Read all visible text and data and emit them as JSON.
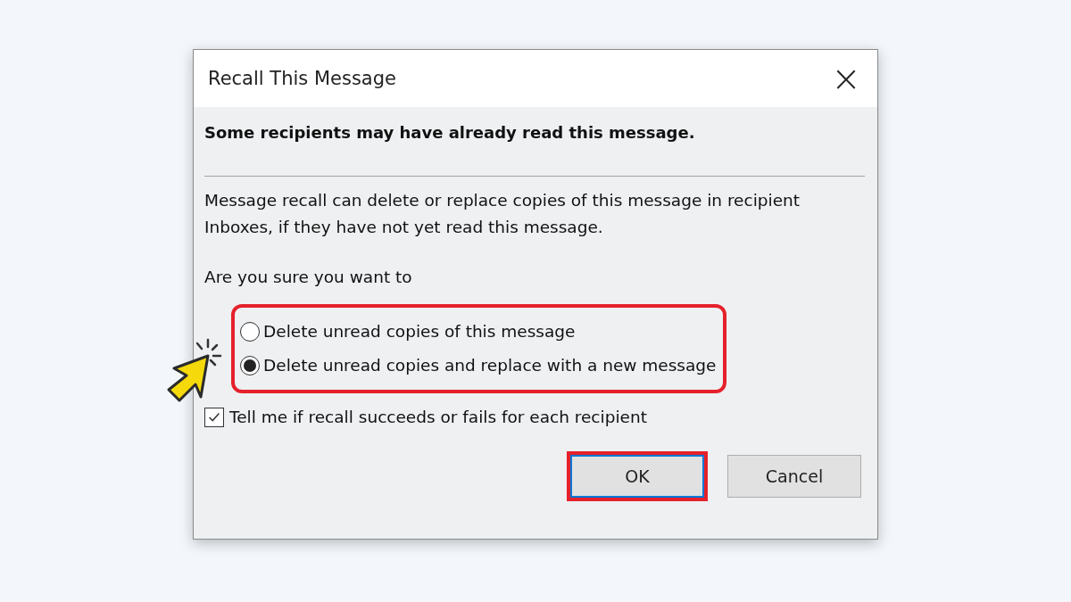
{
  "window": {
    "title": "Recall This Message",
    "close": "×"
  },
  "warning": "Some recipients may have already read this message.",
  "description": "Message recall can delete or replace copies of this message in recipient Inboxes, if they have not yet read this message.",
  "question": "Are you sure you want to",
  "options_highlighted": true,
  "options": [
    {
      "label": "Delete unread copies of this message",
      "selected": false
    },
    {
      "label": "Delete unread copies and replace with a new message",
      "selected": true
    }
  ],
  "checkbox": {
    "label": "Tell me if recall succeeds or fails for each recipient",
    "checked": true
  },
  "buttons": [
    {
      "label": "OK",
      "highlighted": true,
      "focused": true
    },
    {
      "label": "Cancel",
      "highlighted": false,
      "focused": false
    }
  ]
}
